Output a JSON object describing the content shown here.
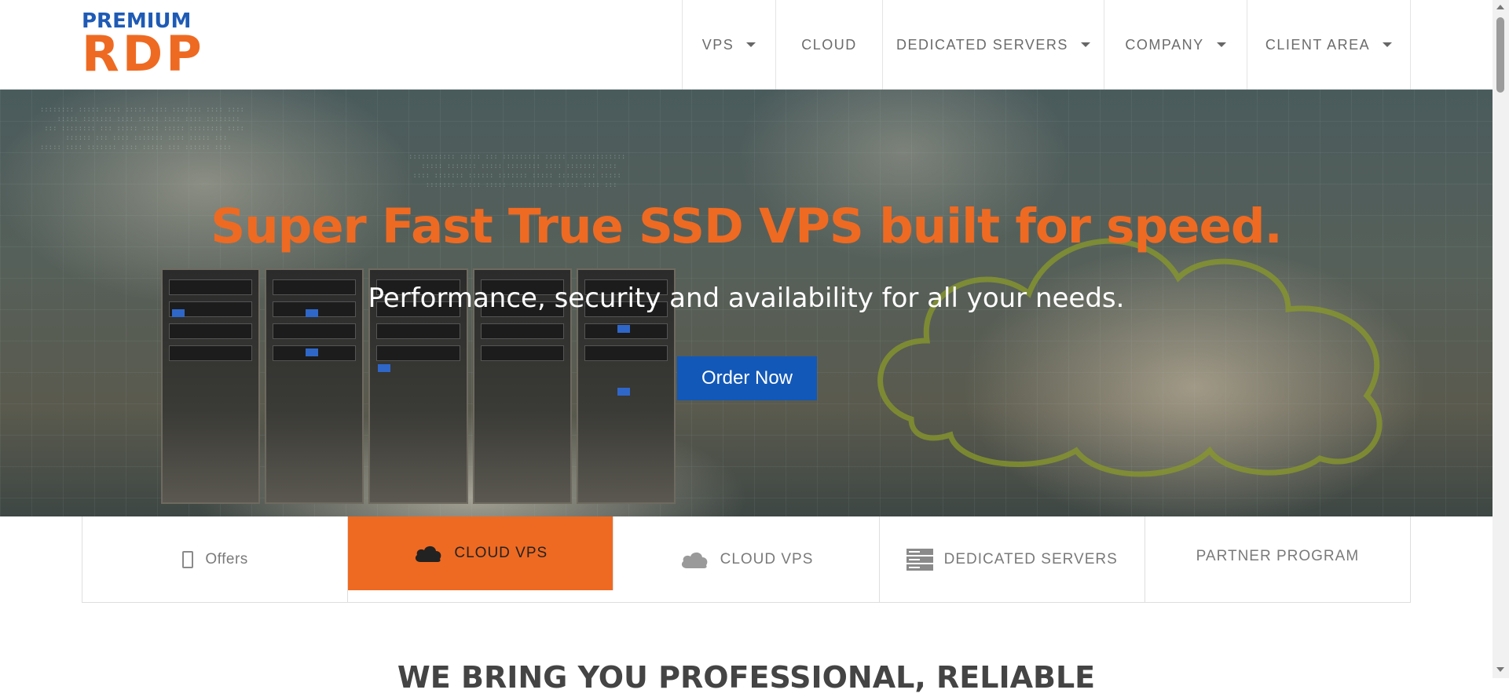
{
  "brand": {
    "logo_top": "PREMIUM",
    "logo_bottom": "RDP"
  },
  "nav": {
    "items": [
      {
        "label": "VPS",
        "has_dropdown": true
      },
      {
        "label": "CLOUD",
        "has_dropdown": false
      },
      {
        "label": "DEDICATED SERVERS",
        "has_dropdown": true
      },
      {
        "label": "COMPANY",
        "has_dropdown": true
      },
      {
        "label": "CLIENT AREA",
        "has_dropdown": true
      }
    ]
  },
  "hero": {
    "title": "Super Fast True SSD VPS built for speed.",
    "subtitle": "Performance, security and availability for all your needs.",
    "cta_label": "Order Now"
  },
  "tabs": [
    {
      "label": "Offers",
      "icon": "mobile-icon"
    },
    {
      "label": "CLOUD VPS",
      "icon": "cloud-icon",
      "active": true
    },
    {
      "label": "CLOUD VPS",
      "icon": "cloud-icon"
    },
    {
      "label": "DEDICATED SERVERS",
      "icon": "server-icon"
    },
    {
      "label": "PARTNER PROGRAM",
      "icon": ""
    }
  ],
  "section": {
    "heading": "WE BRING YOU PROFESSIONAL, RELIABLE"
  },
  "colors": {
    "accent": "#ee6a22",
    "brand_blue": "#1f5bb5",
    "button_blue": "#1258b8"
  }
}
